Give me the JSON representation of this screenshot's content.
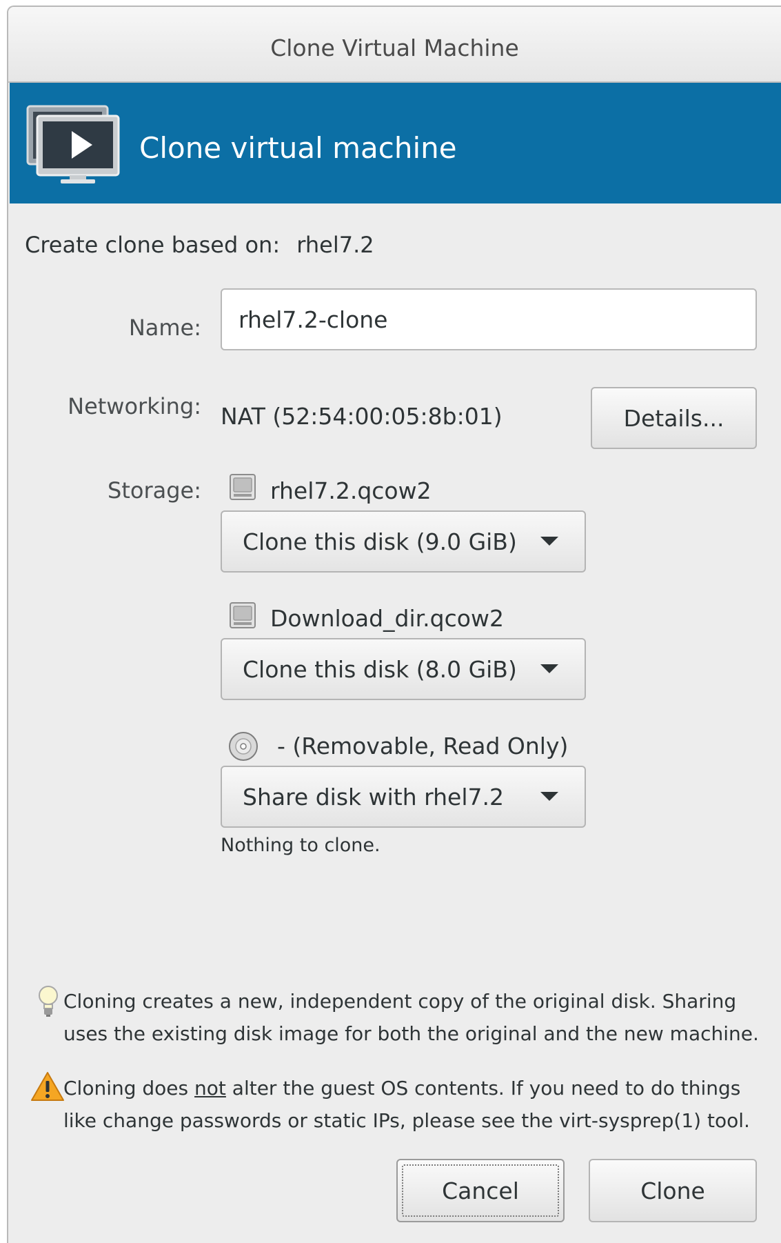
{
  "window": {
    "title": "Clone Virtual Machine"
  },
  "banner": {
    "title": "Clone virtual machine",
    "icon": "monitor-play-icon"
  },
  "form": {
    "based_on_label": "Create clone based on:",
    "based_on_value": "rhel7.2",
    "name_label": "Name:",
    "name_value": "rhel7.2-clone",
    "networking_label": "Networking:",
    "networking_value": "NAT (52:54:00:05:8b:01)",
    "details_button": "Details...",
    "storage_label": "Storage:"
  },
  "storage": {
    "disks": [
      {
        "icon": "harddisk-icon",
        "name": "rhel7.2.qcow2",
        "action": "Clone this disk (9.0 GiB)"
      },
      {
        "icon": "harddisk-icon",
        "name": "Download_dir.qcow2",
        "action": "Clone this disk (8.0 GiB)"
      },
      {
        "icon": "cdrom-icon",
        "name": "- (Removable, Read Only)",
        "action": "Share disk with rhel7.2",
        "note": "Nothing to clone."
      }
    ]
  },
  "info": {
    "tip_icon": "lightbulb-icon",
    "tip_text": "Cloning creates a new, independent copy of the original disk. Sharing uses the existing disk image for both the original and the new machine.",
    "warning_icon": "warning-icon",
    "warning_prefix": "Cloning does ",
    "warning_emphasis": "not",
    "warning_suffix": " alter the guest OS contents. If you need to do things like change passwords or static IPs, please see the virt-sysprep(1) tool."
  },
  "buttons": {
    "cancel": "Cancel",
    "clone": "Clone"
  },
  "colors": {
    "banner": "#0c6fa5",
    "dialog_bg": "#ededed"
  }
}
